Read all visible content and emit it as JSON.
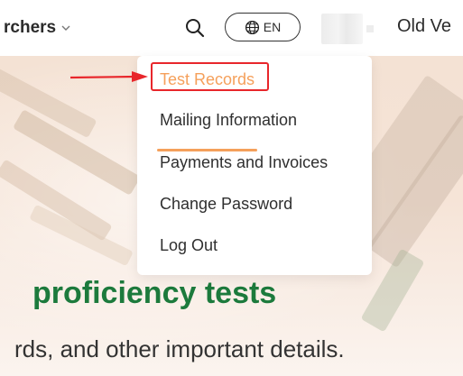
{
  "header": {
    "nav_label": "rchers",
    "lang_label": "EN",
    "user_name": "Old Ve"
  },
  "menu": {
    "items": [
      {
        "label": "Test Records",
        "active": true
      },
      {
        "label": "Mailing Information",
        "active": false
      },
      {
        "label": "Payments and Invoices",
        "active": false
      },
      {
        "label": "Change Password",
        "active": false
      },
      {
        "label": "Log Out",
        "active": false
      }
    ]
  },
  "hero": {
    "title": "proficiency tests",
    "subtitle": "rds, and other important details."
  },
  "colors": {
    "accent": "#f5a05b",
    "title_green": "#1c7a3c",
    "highlight_red": "#e8262b"
  },
  "icons": {
    "chevron": "chevron-down-icon",
    "search": "search-icon",
    "globe": "globe-icon",
    "avatar": "avatar",
    "arrow": "arrow-right-icon"
  }
}
